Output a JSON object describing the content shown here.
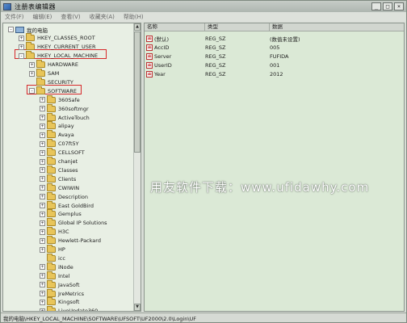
{
  "window": {
    "title": "注册表编辑器"
  },
  "window_buttons": {
    "minimize": "_",
    "maximize": "□",
    "close": "×"
  },
  "menu": [
    "文件(F)",
    "编辑(E)",
    "查看(V)",
    "收藏夹(A)",
    "帮助(H)"
  ],
  "tree": [
    {
      "label": "我的电脑",
      "exp": "-",
      "icon": "computer-icon",
      "indent": 0
    },
    {
      "label": "HKEY_CLASSES_ROOT",
      "exp": "+",
      "icon": "folder-icon",
      "indent": 1
    },
    {
      "label": "HKEY_CURRENT_USER",
      "exp": "+",
      "icon": "folder-icon",
      "indent": 1
    },
    {
      "label": "HKEY_LOCAL_MACHINE",
      "exp": "-",
      "icon": "folder-icon",
      "indent": 1
    },
    {
      "label": "HARDWARE",
      "exp": "+",
      "icon": "folder-icon",
      "indent": 2
    },
    {
      "label": "SAM",
      "exp": "+",
      "icon": "folder-icon",
      "indent": 2
    },
    {
      "label": "SECURITY",
      "exp": "",
      "icon": "folder-icon",
      "indent": 2
    },
    {
      "label": "SOFTWARE",
      "exp": "-",
      "icon": "folder-icon",
      "indent": 2
    },
    {
      "label": "360Safe",
      "exp": "+",
      "icon": "folder-icon",
      "indent": 3
    },
    {
      "label": "360softmgr",
      "exp": "+",
      "icon": "folder-icon",
      "indent": 3
    },
    {
      "label": "ActiveTouch",
      "exp": "+",
      "icon": "folder-icon",
      "indent": 3
    },
    {
      "label": "alipay",
      "exp": "+",
      "icon": "folder-icon",
      "indent": 3
    },
    {
      "label": "Avaya",
      "exp": "+",
      "icon": "folder-icon",
      "indent": 3
    },
    {
      "label": "C07ft5Y",
      "exp": "+",
      "icon": "folder-icon",
      "indent": 3
    },
    {
      "label": "CELLSOFT",
      "exp": "+",
      "icon": "folder-icon",
      "indent": 3
    },
    {
      "label": "chanjet",
      "exp": "+",
      "icon": "folder-icon",
      "indent": 3
    },
    {
      "label": "Classes",
      "exp": "+",
      "icon": "folder-icon",
      "indent": 3
    },
    {
      "label": "Clients",
      "exp": "+",
      "icon": "folder-icon",
      "indent": 3
    },
    {
      "label": "CWIWIN",
      "exp": "+",
      "icon": "folder-icon",
      "indent": 3
    },
    {
      "label": "Description",
      "exp": "+",
      "icon": "folder-icon",
      "indent": 3
    },
    {
      "label": "East GoldBird",
      "exp": "+",
      "icon": "folder-icon",
      "indent": 3
    },
    {
      "label": "Gemplus",
      "exp": "+",
      "icon": "folder-icon",
      "indent": 3
    },
    {
      "label": "Global IP Solutions",
      "exp": "+",
      "icon": "folder-icon",
      "indent": 3
    },
    {
      "label": "H3C",
      "exp": "+",
      "icon": "folder-icon",
      "indent": 3
    },
    {
      "label": "Hewlett-Packard",
      "exp": "+",
      "icon": "folder-icon",
      "indent": 3
    },
    {
      "label": "HP",
      "exp": "+",
      "icon": "folder-icon",
      "indent": 3
    },
    {
      "label": "icc",
      "exp": "",
      "icon": "folder-icon",
      "indent": 3
    },
    {
      "label": "iNode",
      "exp": "+",
      "icon": "folder-icon",
      "indent": 3
    },
    {
      "label": "Intel",
      "exp": "+",
      "icon": "folder-icon",
      "indent": 3
    },
    {
      "label": "JavaSoft",
      "exp": "+",
      "icon": "folder-icon",
      "indent": 3
    },
    {
      "label": "JreMetrics",
      "exp": "+",
      "icon": "folder-icon",
      "indent": 3
    },
    {
      "label": "Kingsoft",
      "exp": "+",
      "icon": "folder-icon",
      "indent": 3
    },
    {
      "label": "LiveUpdate360",
      "exp": "+",
      "icon": "folder-icon",
      "indent": 3
    }
  ],
  "list": {
    "columns": [
      "名称",
      "类型",
      "数据"
    ],
    "rows": [
      {
        "name": "(默认)",
        "type": "REG_SZ",
        "data": "(数值未设置)"
      },
      {
        "name": "AccID",
        "type": "REG_SZ",
        "data": "005"
      },
      {
        "name": "Server",
        "type": "REG_SZ",
        "data": "FUFIDA"
      },
      {
        "name": "UserID",
        "type": "REG_SZ",
        "data": "001"
      },
      {
        "name": "Year",
        "type": "REG_SZ",
        "data": "2012"
      }
    ]
  },
  "watermark": "用友软件下载：www.ufidawhy.com",
  "status": "我的电脑\\HKEY_LOCAL_MACHINE\\SOFTWARE\\UFSOFT\\UF2000\\2.0\\Login\\UF",
  "scrollbar": {
    "up": "▲",
    "down": "▼"
  },
  "value_icon_text": "ab",
  "colors": {
    "highlight": "#d6282a",
    "list_bg": "#dbe9d6",
    "tree_bg": "#e8efe4"
  }
}
